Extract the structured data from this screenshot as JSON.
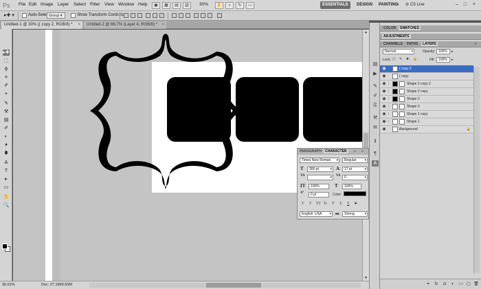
{
  "menubar": {
    "logo": "Ps",
    "items": [
      "File",
      "Edit",
      "Image",
      "Layer",
      "Select",
      "Filter",
      "View",
      "Window",
      "Help"
    ],
    "zoom": "30%",
    "workspaces": [
      "ESSENTIALS",
      "DESIGN",
      "PAINTING",
      "»"
    ],
    "cs_live": "CS Live",
    "window_buttons": [
      "–",
      "□",
      "×"
    ]
  },
  "options_bar": {
    "auto_select_label": "Auto-Select:",
    "auto_select_value": "Group",
    "show_transform_label": "Show Transform Controls"
  },
  "doc_tabs": [
    {
      "label": "Untitled-1 @ 30% ({ copy 2, RGB/8) *",
      "close": "×"
    },
    {
      "label": "Untitled-2 @ 66.7% (Layer 4, RGB/8) *",
      "close": "×"
    }
  ],
  "toolbox": {
    "tools": [
      "▸✚",
      "⬚",
      "ϕ",
      "⌗",
      "✐",
      "⌖",
      "✎",
      "⚒",
      "▤",
      "✐",
      "◐",
      "♦",
      "⬮",
      "A",
      "T",
      "▸",
      "▭",
      "✋",
      "🔍"
    ]
  },
  "status": {
    "zoom": "30.01%",
    "doc": "Doc: 27.1M/8.50M"
  },
  "character_panel": {
    "tabs": [
      "PARAGRAPH",
      "CHARACTER"
    ],
    "font_family": "Times New Roman",
    "font_style": "Regular",
    "font_size": "300 pt",
    "leading": "17 pt",
    "kerning": "",
    "tracking": "0",
    "vscale": "100%",
    "hscale": "100%",
    "baseline": "0 pt",
    "color_label": "Color:",
    "format_buttons": [
      "T",
      "T",
      "TT",
      "Tr",
      "T'",
      "T,",
      "T",
      "T"
    ],
    "language": "English: USA",
    "antialias_icon": "aa",
    "antialias": "Strong"
  },
  "panels": {
    "top_tabs": [
      "COLOR",
      "SWATCHES"
    ],
    "adjustments_tab": "ADJUSTMENTS",
    "layer_tabs": [
      "CHANNELS",
      "PATHS",
      "LAYERS"
    ],
    "blend_mode": "Normal",
    "opacity_label": "Opacity:",
    "opacity": "100%",
    "lock_label": "Lock:",
    "fill_label": "Fill:",
    "fill": "100%",
    "layers": [
      {
        "name": "{ copy 2",
        "selected": true,
        "thumb": "white",
        "mask": false
      },
      {
        "name": "{ copy",
        "selected": false,
        "thumb": "white",
        "mask": false
      },
      {
        "name": "Shape 2 copy 2",
        "selected": false,
        "thumb": "black",
        "mask": true
      },
      {
        "name": "Shape 2 copy",
        "selected": false,
        "thumb": "black",
        "mask": true
      },
      {
        "name": "Shape 2",
        "selected": false,
        "thumb": "black",
        "mask": true
      },
      {
        "name": "Shape 3",
        "selected": false,
        "thumb": "white",
        "mask": true
      },
      {
        "name": "Shape 1 copy",
        "selected": false,
        "thumb": "white",
        "mask": true
      },
      {
        "name": "Shape 1",
        "selected": false,
        "thumb": "white",
        "mask": true
      },
      {
        "name": "Background",
        "selected": false,
        "thumb": "white",
        "mask": false,
        "italic": true,
        "locked": true
      }
    ]
  },
  "colors": {
    "selection": "#3a6cc4",
    "canvas": "#c4c4c4"
  }
}
